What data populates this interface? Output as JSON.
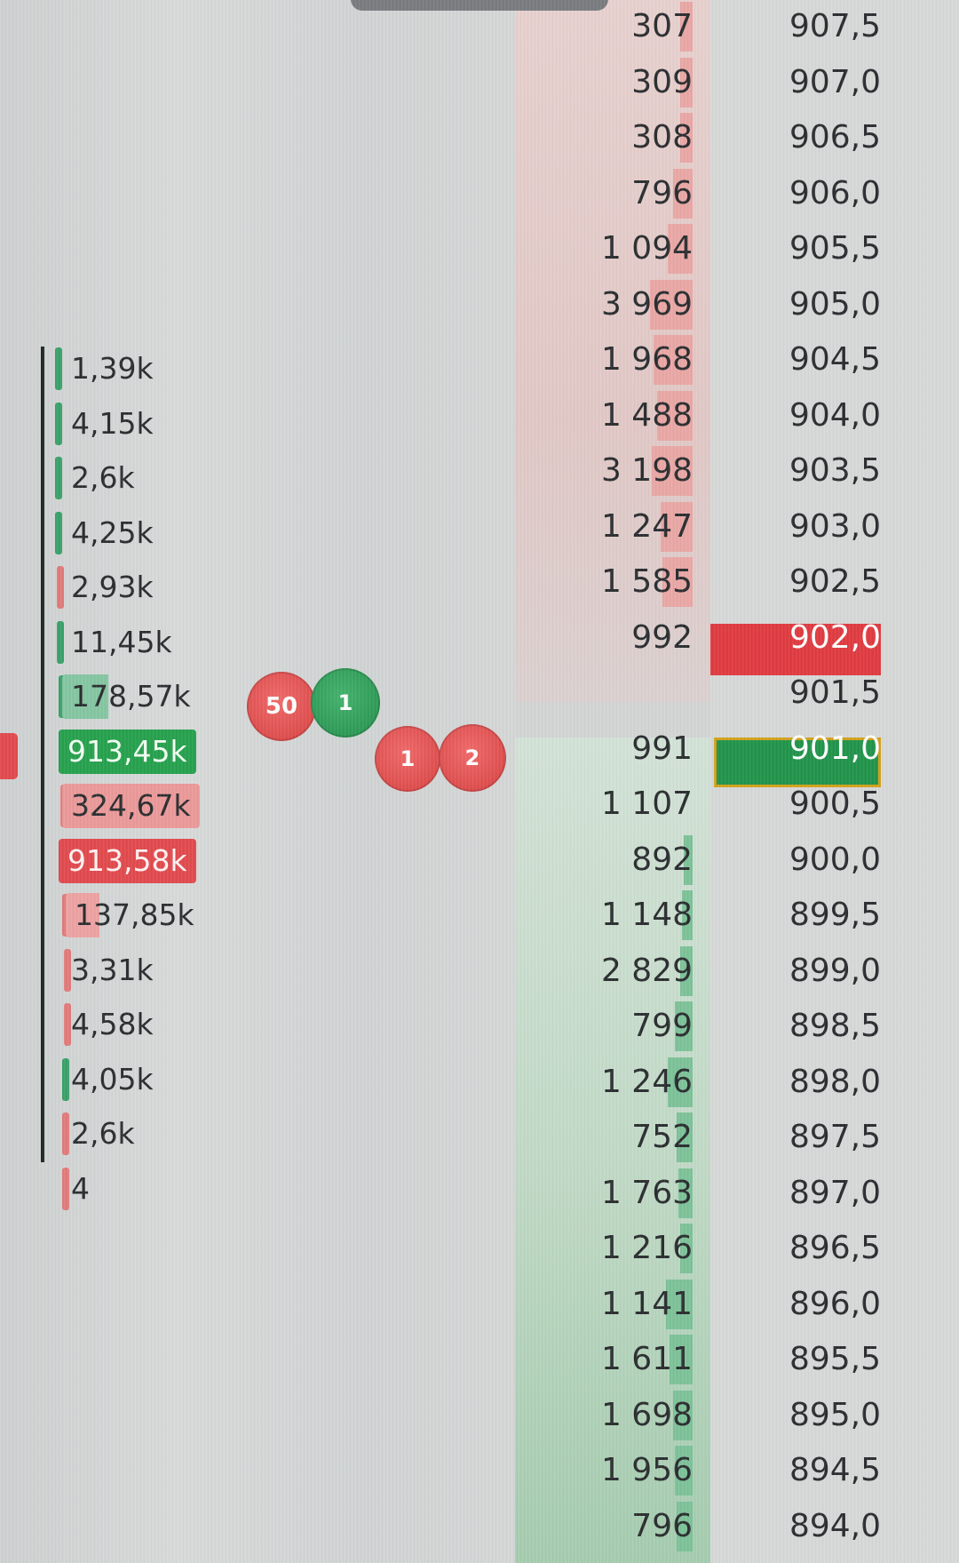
{
  "profile": {
    "labels": [
      {
        "text": "1,39k",
        "bar": "green"
      },
      {
        "text": "4,15k",
        "bar": "green"
      },
      {
        "text": "2,6k",
        "bar": "green"
      },
      {
        "text": "4,25k",
        "bar": "green"
      },
      {
        "text": "2,93k",
        "bar": "red"
      },
      {
        "text": "11,45k",
        "bar": "green"
      },
      {
        "text": "178,57k",
        "bar": "green"
      },
      {
        "text": "913,45k",
        "bar": "green"
      },
      {
        "text": "324,67k",
        "bar": "red"
      },
      {
        "text": "913,58k",
        "bar": "red"
      },
      {
        "text": "137,85k",
        "bar": "red"
      },
      {
        "text": "3,31k",
        "bar": "red"
      },
      {
        "text": "4,58k",
        "bar": "red"
      },
      {
        "text": "4,05k",
        "bar": "green"
      },
      {
        "text": "2,6k",
        "bar": "red"
      },
      {
        "text": "4",
        "bar": "red"
      }
    ]
  },
  "trades": [
    {
      "qty": "50",
      "side": "sell"
    },
    {
      "qty": "1",
      "side": "buy"
    },
    {
      "qty": "1",
      "side": "sell"
    },
    {
      "qty": "2",
      "side": "sell"
    }
  ],
  "ladder": {
    "rows": [
      {
        "volume": "307",
        "price": "907,5",
        "side": "ask"
      },
      {
        "volume": "309",
        "price": "907,0",
        "side": "ask"
      },
      {
        "volume": "308",
        "price": "906,5",
        "side": "ask"
      },
      {
        "volume": "796",
        "price": "906,0",
        "side": "ask"
      },
      {
        "volume": "1 094",
        "price": "905,5",
        "side": "ask"
      },
      {
        "volume": "3 969",
        "price": "905,0",
        "side": "ask"
      },
      {
        "volume": "1 968",
        "price": "904,5",
        "side": "ask"
      },
      {
        "volume": "1 488",
        "price": "904,0",
        "side": "ask"
      },
      {
        "volume": "3 198",
        "price": "903,5",
        "side": "ask"
      },
      {
        "volume": "1 247",
        "price": "903,0",
        "side": "ask"
      },
      {
        "volume": "1 585",
        "price": "902,5",
        "side": "ask"
      },
      {
        "volume": "992",
        "price": "902,0",
        "side": "ask",
        "best_ask": true
      },
      {
        "volume": "",
        "price": "901,5",
        "side": "spread"
      },
      {
        "volume": "991",
        "price": "901,0",
        "side": "bid",
        "best_bid": true
      },
      {
        "volume": "1 107",
        "price": "900,5",
        "side": "bid"
      },
      {
        "volume": "892",
        "price": "900,0",
        "side": "bid"
      },
      {
        "volume": "1 148",
        "price": "899,5",
        "side": "bid"
      },
      {
        "volume": "2 829",
        "price": "899,0",
        "side": "bid"
      },
      {
        "volume": "799",
        "price": "898,5",
        "side": "bid"
      },
      {
        "volume": "1 246",
        "price": "898,0",
        "side": "bid"
      },
      {
        "volume": "752",
        "price": "897,5",
        "side": "bid"
      },
      {
        "volume": "1 763",
        "price": "897,0",
        "side": "bid"
      },
      {
        "volume": "1 216",
        "price": "896,5",
        "side": "bid"
      },
      {
        "volume": "1 141",
        "price": "896,0",
        "side": "bid"
      },
      {
        "volume": "1 611",
        "price": "895,5",
        "side": "bid"
      },
      {
        "volume": "1 698",
        "price": "895,0",
        "side": "bid"
      },
      {
        "volume": "1 956",
        "price": "894,5",
        "side": "bid"
      },
      {
        "volume": "796",
        "price": "894,0",
        "side": "bid"
      }
    ]
  },
  "colors": {
    "ask": "#e03c42",
    "bid": "#22954c",
    "best_bid_border": "#d4a21c"
  }
}
